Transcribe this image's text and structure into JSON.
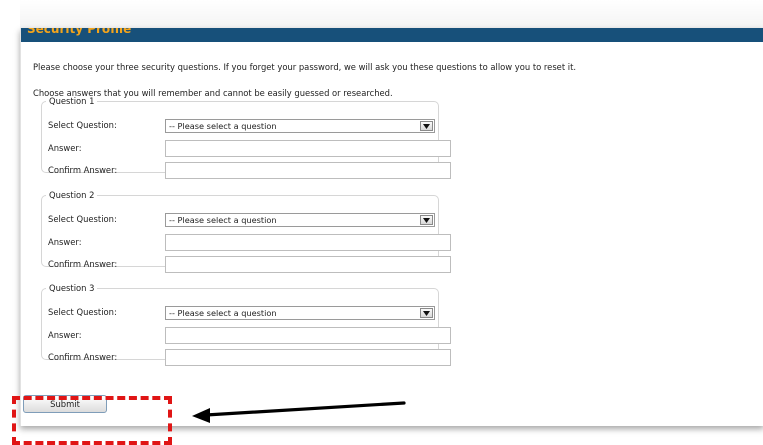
{
  "header": {
    "title": "Security Profile"
  },
  "intro": {
    "line1": "Please choose your three security questions. If you forget your password, we will ask you these questions to allow you to reset it.",
    "line2": "Choose answers that you will remember and cannot be easily guessed or researched."
  },
  "questions": [
    {
      "legend": "Question 1",
      "select_label": "Select Question:",
      "select_value": "-- Please select a question",
      "answer_label": "Answer:",
      "answer_value": "",
      "confirm_label": "Confirm Answer:",
      "confirm_value": ""
    },
    {
      "legend": "Question 2",
      "select_label": "Select Question:",
      "select_value": "-- Please select a question",
      "answer_label": "Answer:",
      "answer_value": "",
      "confirm_label": "Confirm Answer:",
      "confirm_value": ""
    },
    {
      "legend": "Question 3",
      "select_label": "Select Question:",
      "select_value": "-- Please select a question",
      "answer_label": "Answer:",
      "answer_value": "",
      "confirm_label": "Confirm Answer:",
      "confirm_value": ""
    }
  ],
  "actions": {
    "submit_label": "Submit"
  },
  "annotation": {
    "highlight_color": "#e01515",
    "arrow_color": "#000000"
  },
  "colors": {
    "header_bg": "#17507a",
    "header_text": "#f2a41c"
  }
}
